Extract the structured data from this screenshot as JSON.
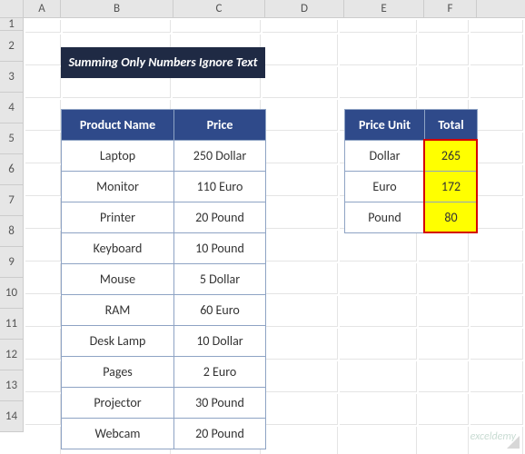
{
  "columns": [
    "A",
    "B",
    "C",
    "D",
    "E",
    "F"
  ],
  "rows": [
    "1",
    "2",
    "3",
    "4",
    "5",
    "6",
    "7",
    "8",
    "9",
    "10",
    "11",
    "12",
    "13",
    "14"
  ],
  "title": "Summing Only Numbers Ignore Text",
  "table1": {
    "headers": {
      "product": "Product Name",
      "price": "Price"
    },
    "rows": [
      {
        "product": "Laptop",
        "price": "250 Dollar"
      },
      {
        "product": "Monitor",
        "price": "110 Euro"
      },
      {
        "product": "Printer",
        "price": "20 Pound"
      },
      {
        "product": "Keyboard",
        "price": "10 Pound"
      },
      {
        "product": "Mouse",
        "price": "5 Dollar"
      },
      {
        "product": "RAM",
        "price": "60 Euro"
      },
      {
        "product": "Desk Lamp",
        "price": "10 Dollar"
      },
      {
        "product": "Pages",
        "price": "2 Euro"
      },
      {
        "product": "Projector",
        "price": "30 Pound"
      },
      {
        "product": "Webcam",
        "price": "20 Pound"
      }
    ]
  },
  "table2": {
    "headers": {
      "unit": "Price Unit",
      "total": "Total"
    },
    "rows": [
      {
        "unit": "Dollar",
        "total": "265"
      },
      {
        "unit": "Euro",
        "total": "172"
      },
      {
        "unit": "Pound",
        "total": "80"
      }
    ]
  },
  "watermark": "exceldemy",
  "chart_data": {
    "type": "table",
    "title": "Summing Only Numbers Ignore Text",
    "series": [
      {
        "name": "Dollar",
        "values": [
          250,
          5,
          10
        ],
        "total": 265
      },
      {
        "name": "Euro",
        "values": [
          110,
          60,
          2
        ],
        "total": 172
      },
      {
        "name": "Pound",
        "values": [
          20,
          10,
          30,
          20
        ],
        "total": 80
      }
    ]
  }
}
